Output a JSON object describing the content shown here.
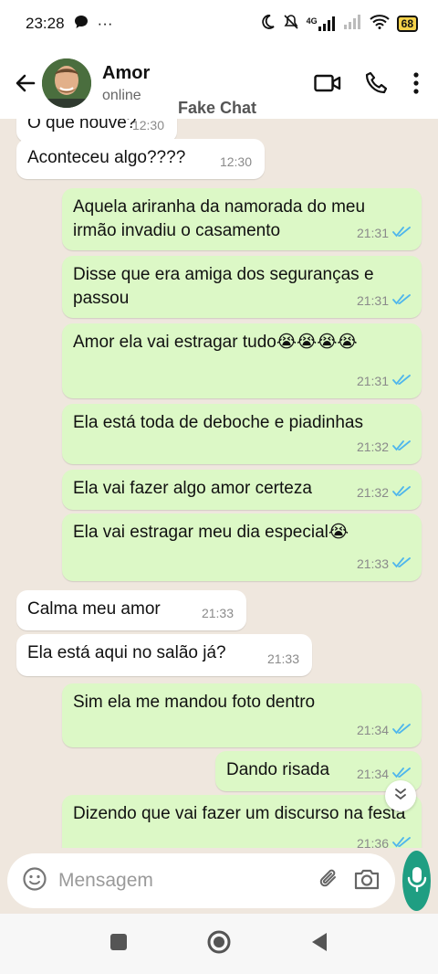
{
  "status_bar": {
    "time": "23:28",
    "more": "···",
    "network": "4G",
    "battery": "68"
  },
  "header": {
    "contact_name": "Amor",
    "contact_status": "online",
    "watermark": "Fake Chat"
  },
  "messages": [
    {
      "dir": "in",
      "text": "O que houve?",
      "time": "12:30"
    },
    {
      "dir": "in",
      "text": "Aconteceu algo????",
      "time": "12:30"
    },
    {
      "dir": "out",
      "text": "Aquela ariranha da namorada do meu irmão invadiu o casamento",
      "time": "21:31"
    },
    {
      "dir": "out",
      "text": "Disse que era amiga dos seguranças e passou",
      "time": "21:31"
    },
    {
      "dir": "out",
      "text": "Amor ela vai estragar tudo😭😭😭😭",
      "time": "21:31"
    },
    {
      "dir": "out",
      "text": "Ela está toda de deboche e piadinhas",
      "time": "21:32"
    },
    {
      "dir": "out",
      "text": "Ela vai fazer algo amor certeza",
      "time": "21:32"
    },
    {
      "dir": "out",
      "text": "Ela vai estragar meu dia especial😭",
      "time": "21:33"
    },
    {
      "dir": "in",
      "text": "Calma meu amor",
      "time": "21:33"
    },
    {
      "dir": "in",
      "text": "Ela está aqui no salão já?",
      "time": "21:33"
    },
    {
      "dir": "out",
      "text": "Sim ela me mandou foto dentro",
      "time": "21:34"
    },
    {
      "dir": "out",
      "text": "Dando risada",
      "time": "21:34"
    },
    {
      "dir": "out",
      "text": "Dizendo que vai fazer um discurso na festa",
      "time": "21:36"
    }
  ],
  "input": {
    "placeholder": "Mensagem"
  },
  "colors": {
    "outgoing_bubble": "#dcf8c6",
    "incoming_bubble": "#ffffff",
    "accent": "#1f9e82",
    "read_ticks": "#4fb6ec"
  },
  "icons": {
    "back": "arrow-left-icon",
    "video": "video-call-icon",
    "call": "phone-icon",
    "menu": "more-vertical-icon",
    "emoji": "emoji-icon",
    "attach": "paperclip-icon",
    "camera": "camera-icon",
    "mic": "microphone-icon"
  }
}
